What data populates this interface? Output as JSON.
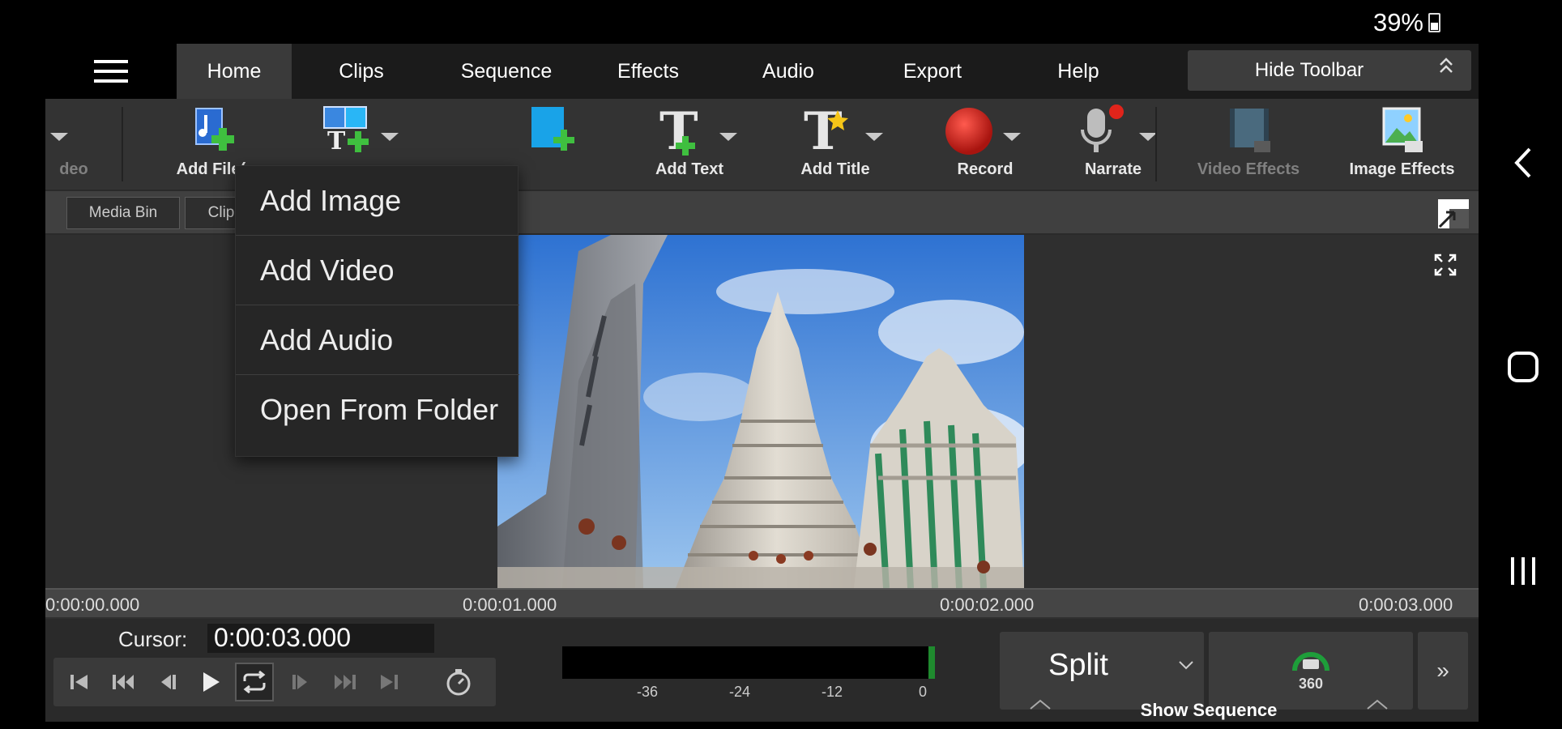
{
  "status_bar": {
    "battery": "39%"
  },
  "tabs": [
    {
      "label": "Home",
      "active": true
    },
    {
      "label": "Clips"
    },
    {
      "label": "Sequence"
    },
    {
      "label": "Effects"
    },
    {
      "label": "Audio"
    },
    {
      "label": "Export"
    },
    {
      "label": "Help"
    }
  ],
  "hide_toolbar": {
    "label": "Hide Toolbar",
    "icon": "double-chevron-up-icon"
  },
  "toolbar": {
    "partial_label": "deo",
    "add_files": "Add File(s",
    "add_text": "Add Text",
    "add_title": "Add Title",
    "record": "Record",
    "narrate": "Narrate",
    "video_effects": "Video Effects",
    "image_effects": "Image Effects"
  },
  "subtabs": {
    "media_bin": "Media Bin",
    "clips": "Clip"
  },
  "dropdown_menu": {
    "items": [
      "Add Image",
      "Add Video",
      "Add Audio",
      "Open From Folder"
    ]
  },
  "timeline": {
    "ticks": [
      "0:00:00.000",
      "0:00:01.000",
      "0:00:02.000",
      "0:00:03.000"
    ]
  },
  "controls": {
    "cursor_label": "Cursor:",
    "cursor_value": "0:00:03.000",
    "meter_labels": [
      "-36",
      "-24",
      "-12",
      "0"
    ],
    "split_label": "Split",
    "btn_360_label": "360",
    "more_label": "»",
    "show_sequence": "Show Sequence"
  },
  "colors": {
    "accent_green": "#1f8a2e",
    "record_red": "#c0201b",
    "toolbar_bg": "#333333"
  }
}
